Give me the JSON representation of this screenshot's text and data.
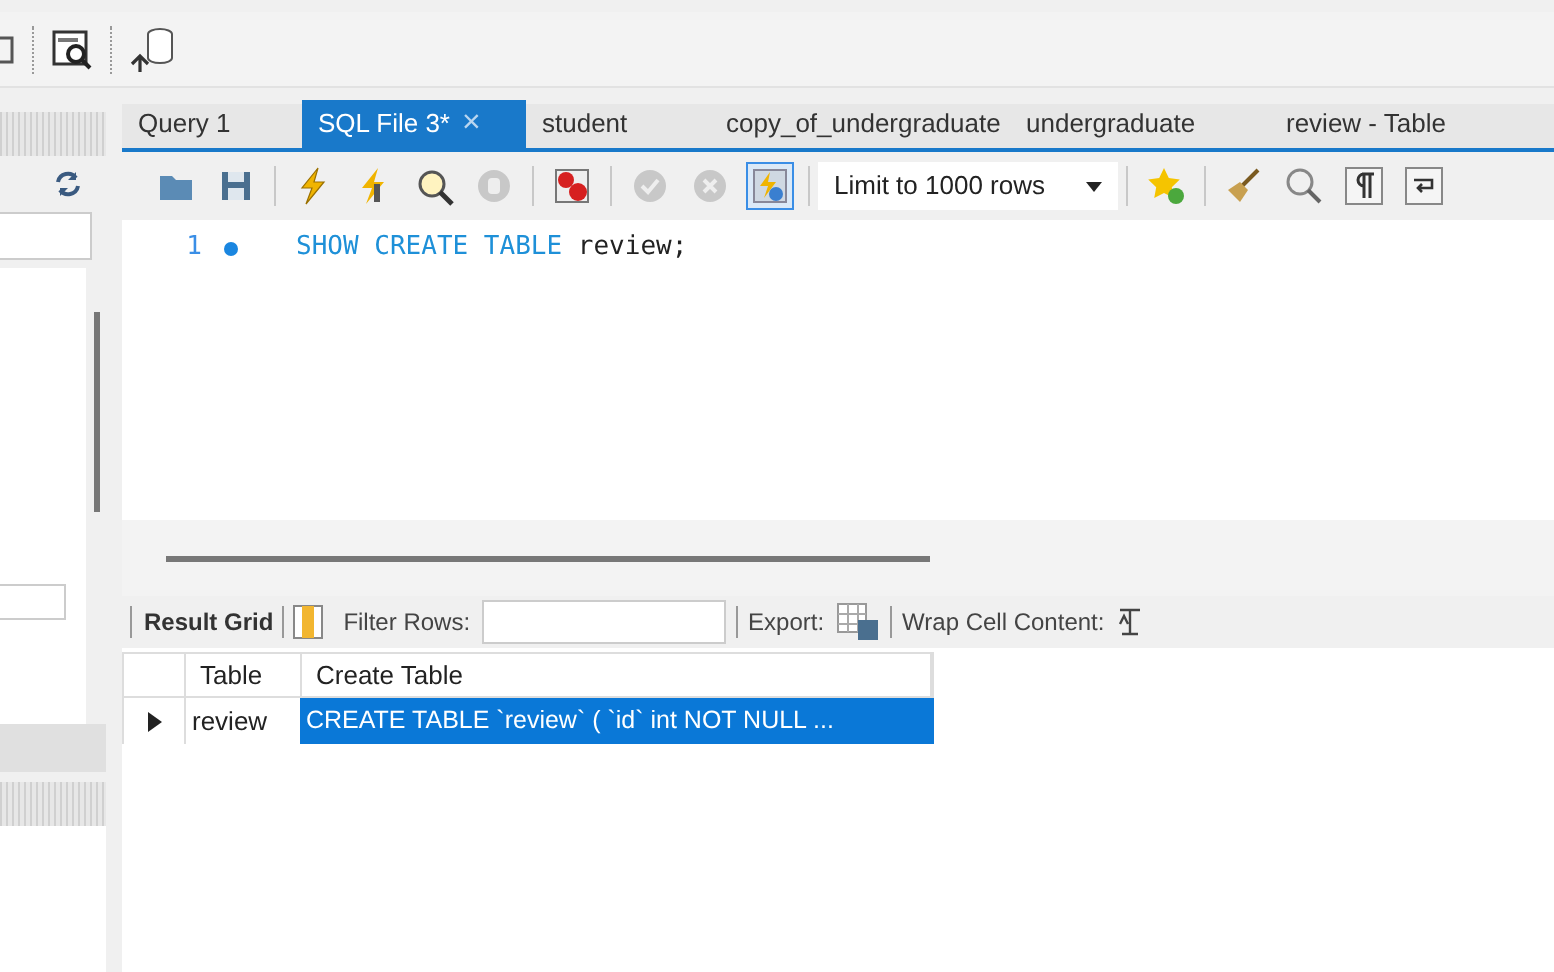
{
  "tabs": [
    {
      "label": "Query 1",
      "selected": false
    },
    {
      "label": "SQL File 3*",
      "selected": true
    },
    {
      "label": "student",
      "selected": false
    },
    {
      "label": "copy_of_undergraduate",
      "selected": false
    },
    {
      "label": "undergraduate",
      "selected": false
    },
    {
      "label": "review - Table",
      "selected": false
    }
  ],
  "close_glyph": "×",
  "limit_select": {
    "value": "Limit to 1000 rows"
  },
  "editor": {
    "lines": [
      {
        "number": "1",
        "keywords": "SHOW CREATE TABLE",
        "rest": "review;"
      }
    ]
  },
  "result_toolbar": {
    "result_grid": "Result Grid",
    "filter_label": "Filter Rows:",
    "export_label": "Export:",
    "wrap_label": "Wrap Cell Content:"
  },
  "table": {
    "columns": [
      "Table",
      "Create Table"
    ],
    "rows": [
      {
        "current": true,
        "cells": [
          {
            "text": "review",
            "selected": false
          },
          {
            "text": "CREATE TABLE `review` (   `id` int NOT NULL ...",
            "selected": true
          }
        ]
      }
    ]
  }
}
